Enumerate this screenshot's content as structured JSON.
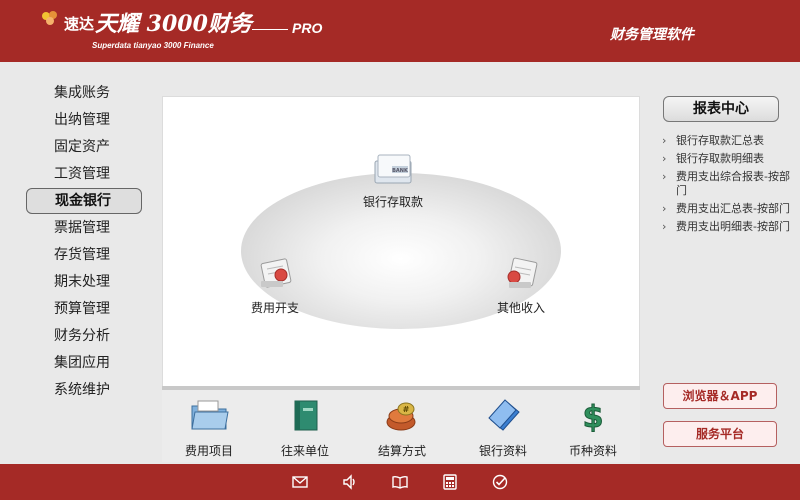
{
  "header": {
    "logo_short": "速达",
    "logo_main": "天耀 3000财务",
    "logo_pro": "PRO",
    "logo_sub": "Superdata tianyao 3000 Finance",
    "right_title": "财务管理软件"
  },
  "sidebar": {
    "items": [
      {
        "label": "集成账务"
      },
      {
        "label": "出纳管理"
      },
      {
        "label": "固定资产"
      },
      {
        "label": "工资管理"
      },
      {
        "label": "现金银行",
        "active": true
      },
      {
        "label": "票据管理"
      },
      {
        "label": "存货管理"
      },
      {
        "label": "期末处理"
      },
      {
        "label": "预算管理"
      },
      {
        "label": "财务分析"
      },
      {
        "label": "集团应用"
      },
      {
        "label": "系统维护"
      }
    ]
  },
  "main": {
    "nodes": {
      "deposit": {
        "label": "银行存取款",
        "icon": "bank-card-icon"
      },
      "expense": {
        "label": "费用开支",
        "icon": "expense-icon"
      },
      "income": {
        "label": "其他收入",
        "icon": "income-icon"
      }
    },
    "bottom": [
      {
        "label": "费用项目",
        "icon": "folder-icon"
      },
      {
        "label": "往来单位",
        "icon": "book-icon"
      },
      {
        "label": "结算方式",
        "icon": "coins-icon"
      },
      {
        "label": "银行资料",
        "icon": "document-icon"
      },
      {
        "label": "币种资料",
        "icon": "dollar-icon"
      }
    ]
  },
  "right": {
    "report_center": "报表中心",
    "reports": [
      {
        "label": "银行存取款汇总表"
      },
      {
        "label": "银行存取款明细表"
      },
      {
        "label": "费用支出综合报表-按部门"
      },
      {
        "label": "费用支出汇总表-按部门"
      },
      {
        "label": "费用支出明细表-按部门"
      }
    ],
    "browser_app": "浏览器＆APP",
    "service_platform": "服务平台"
  },
  "footer": {
    "icons": [
      "mail-icon",
      "sound-icon",
      "manual-icon",
      "calculator-icon",
      "check-icon"
    ]
  },
  "colors": {
    "brand_red": "#a52a26",
    "background": "#e9e9e9",
    "button_pink": "#fdeeee"
  }
}
